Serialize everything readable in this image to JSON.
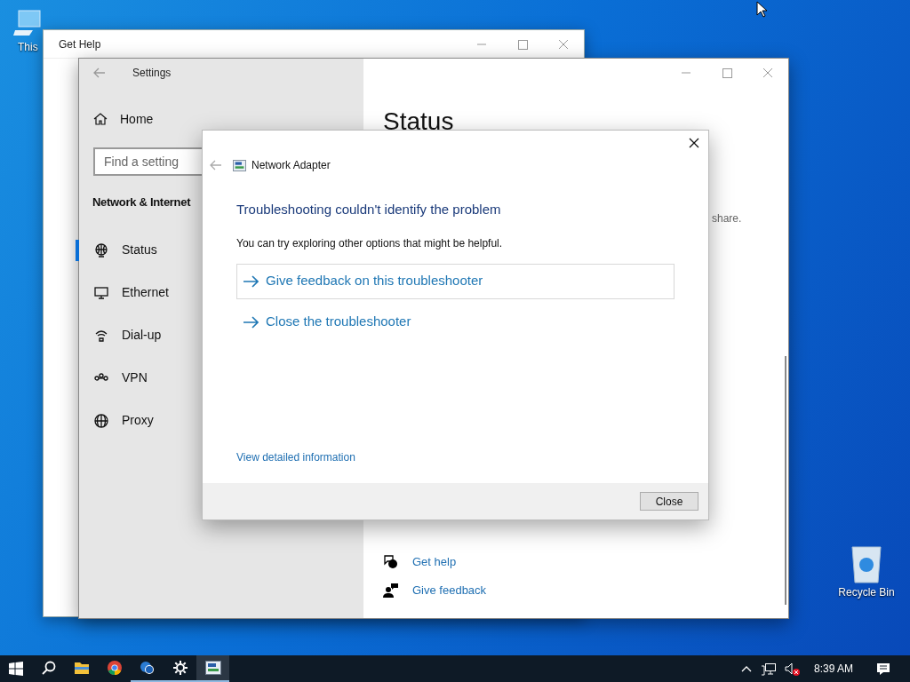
{
  "desktop_icons": [
    {
      "kind": "computer",
      "label": "This"
    },
    {
      "kind": "recycle",
      "label": "Recycle Bin"
    }
  ],
  "get_help_window": {
    "title": "Get Help"
  },
  "settings_window": {
    "title": "Settings",
    "home": "Home",
    "search": {
      "placeholder": "Find a setting"
    },
    "section": "Network & Internet",
    "nav_items": [
      {
        "kind": "status",
        "label": "Status",
        "selected": true
      },
      {
        "kind": "ethernet",
        "label": "Ethernet",
        "selected": false
      },
      {
        "kind": "dialup",
        "label": "Dial-up",
        "selected": false
      },
      {
        "kind": "vpn",
        "label": "VPN",
        "selected": false
      },
      {
        "kind": "proxy",
        "label": "Proxy",
        "selected": false
      }
    ],
    "heading": "Status",
    "partial_text": "share.",
    "links": [
      {
        "kind": "help",
        "label": "Get help"
      },
      {
        "kind": "feedback",
        "label": "Give feedback"
      }
    ]
  },
  "dialog": {
    "title": "Network Adapter",
    "heading": "Troubleshooting couldn't identify the problem",
    "description": "You can try exploring other options that might be helpful.",
    "options": [
      {
        "label": "Give feedback on this troubleshooter",
        "selected": true
      },
      {
        "label": "Close the troubleshooter",
        "selected": false
      }
    ],
    "details_link": "View detailed information",
    "close_button": "Close"
  },
  "taskbar": {
    "apps": [
      {
        "kind": "search",
        "running": false,
        "selected": false
      },
      {
        "kind": "folder",
        "running": false,
        "selected": false
      },
      {
        "kind": "chrome",
        "running": false,
        "selected": false
      },
      {
        "kind": "help",
        "running": true,
        "selected": false
      },
      {
        "kind": "settings",
        "running": true,
        "selected": false
      },
      {
        "kind": "adapter",
        "running": true,
        "selected": true
      }
    ],
    "time": "8:39 AM"
  }
}
